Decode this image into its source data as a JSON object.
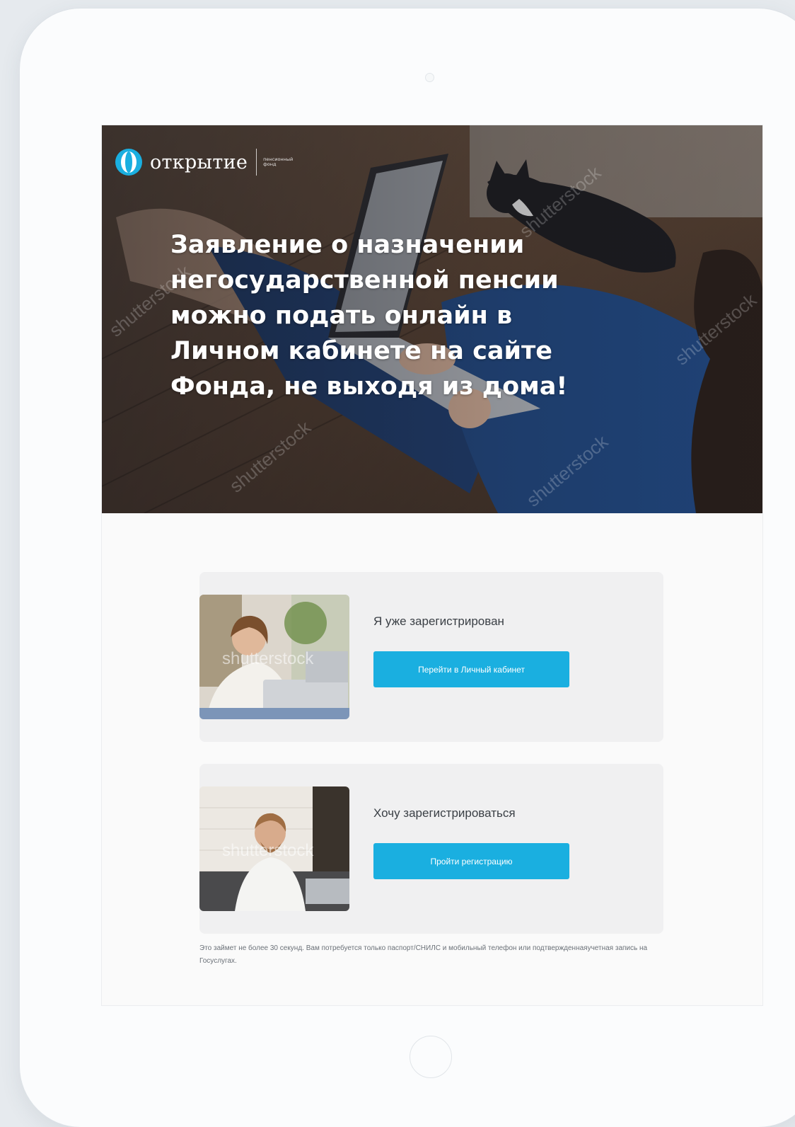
{
  "brand": {
    "name": "открытие",
    "subtitle": "пенсионный фонд",
    "accent": "#1aafe0"
  },
  "hero": {
    "title": "Заявление о назначении негосударственной пенсии можно подать онлайн в Личном кабинете на сайте Фонда, не выходя из дома!",
    "watermark": "shutterstock"
  },
  "options": [
    {
      "title": "Я уже зарегистрирован",
      "button": "Перейти в Личный кабинет",
      "watermark": "shutterstock"
    },
    {
      "title": "Хочу зарегистрироваться",
      "button": "Пройти регистрацию",
      "watermark": "shutterstock"
    }
  ],
  "footnote": "Это займет не более 30 секунд. Вам потребуется только паспорт/СНИЛС и мобильный телефон или подтвержденнаяучетная запись на Госуслугах."
}
